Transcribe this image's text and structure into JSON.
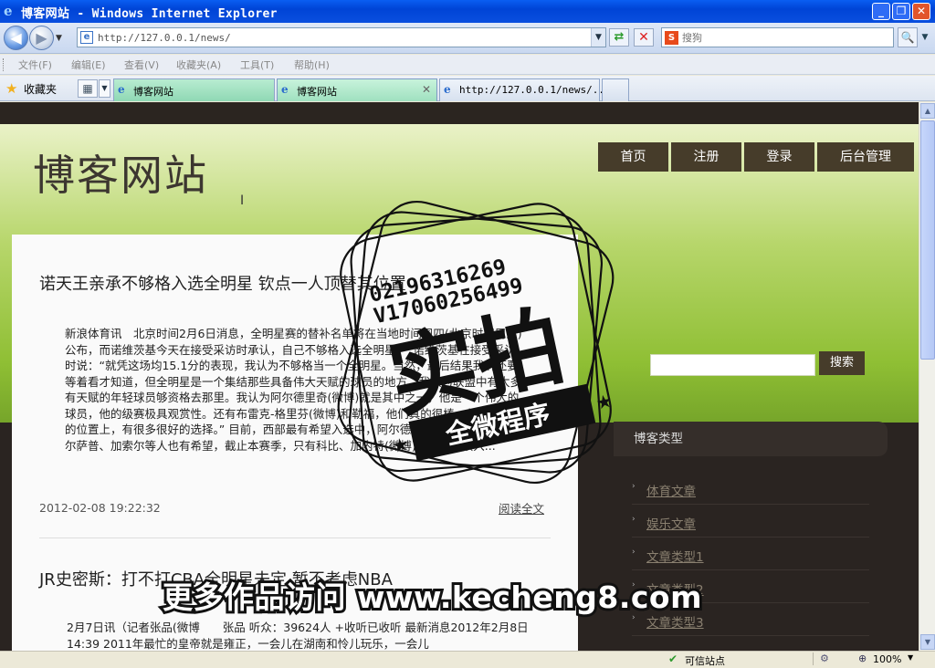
{
  "window": {
    "title": "博客网站 - Windows Internet Explorer",
    "minimize": "_",
    "restore": "❐",
    "close": "✕"
  },
  "nav": {
    "back": "◀",
    "forward": "▶",
    "url": "http://127.0.0.1/news/",
    "search_placeholder": "搜狗",
    "search_logo": "S"
  },
  "menu": {
    "items": [
      "文件(F)",
      "编辑(E)",
      "查看(V)",
      "收藏夹(A)",
      "工具(T)",
      "帮助(H)"
    ]
  },
  "favorites": {
    "label": "收藏夹"
  },
  "tabs": [
    {
      "label": "博客网站",
      "close": ""
    },
    {
      "label": "博客网站",
      "close": "✕"
    },
    {
      "label": "http://127.0.0.1/news/...",
      "close": ""
    }
  ],
  "page": {
    "site_title": "博客网站",
    "nav_items": [
      "首页",
      "注册",
      "登录",
      "后台管理"
    ],
    "search_button": "搜索",
    "categories_header": "博客类型",
    "categories": [
      "体育文章",
      "娱乐文章",
      "文章类型1",
      "文章类型2",
      "文章类型3"
    ],
    "posts": [
      {
        "title": "诺天王亲承不够格入选全明星 钦点一人顶替其位置",
        "body": "新浪体育讯　北京时间2月6日消息，全明星赛的替补名单将在当地时间周四(北京时间周五)公布，而诺维茨基今天在接受采访时承认，自己不够格入选全明星。　诺维茨基在接受采访时说：“就凭这场均15.1分的表现，我认为不够格当一个全明星。当然，最后结果我们还要等着看才知道，但全明星是一个集结那些具备伟大天赋的球员的地方，我认为联盟中有太多有天赋的年轻球员够资格去那里。我认为阿尔德里奇(微博)就是其中之一，他是一个伟大的球员，他的级赛极具观赏性。还有布雷克-格里芬(微博)和勒福，他们真的很棒，总之，在我的位置上，有很多很好的选择。” 目前，西部最有希望入选中，阿尔德里奇是热门，勒福、米尔萨普、加索尔等人也有希望，截止本赛季，只有科比、加内特(微博)、邓肯连续入...",
        "date": "2012-02-08 19:22:32",
        "read_more": "阅读全文"
      },
      {
        "title": "JR史密斯：打不打CBA全明星未定 暂不考虑NBA",
        "body": "2月7日讯（记者张品(微博　　张品  听众：39624人  +收听已收听  最新消息2012年2月8日14:39  2011年最忙的皇帝就是雍正，一会儿在湖南和怜儿玩乐，一会儿"
      }
    ]
  },
  "statusbar": {
    "zone": "可信站点",
    "zoom": "100%"
  },
  "watermark": {
    "phone1": "02196316269",
    "phone2": "V17060256499",
    "stamp_big": "实拍",
    "stamp_small": "全微程序",
    "url_text": "更多作品访问 www.kecheng8.com"
  }
}
